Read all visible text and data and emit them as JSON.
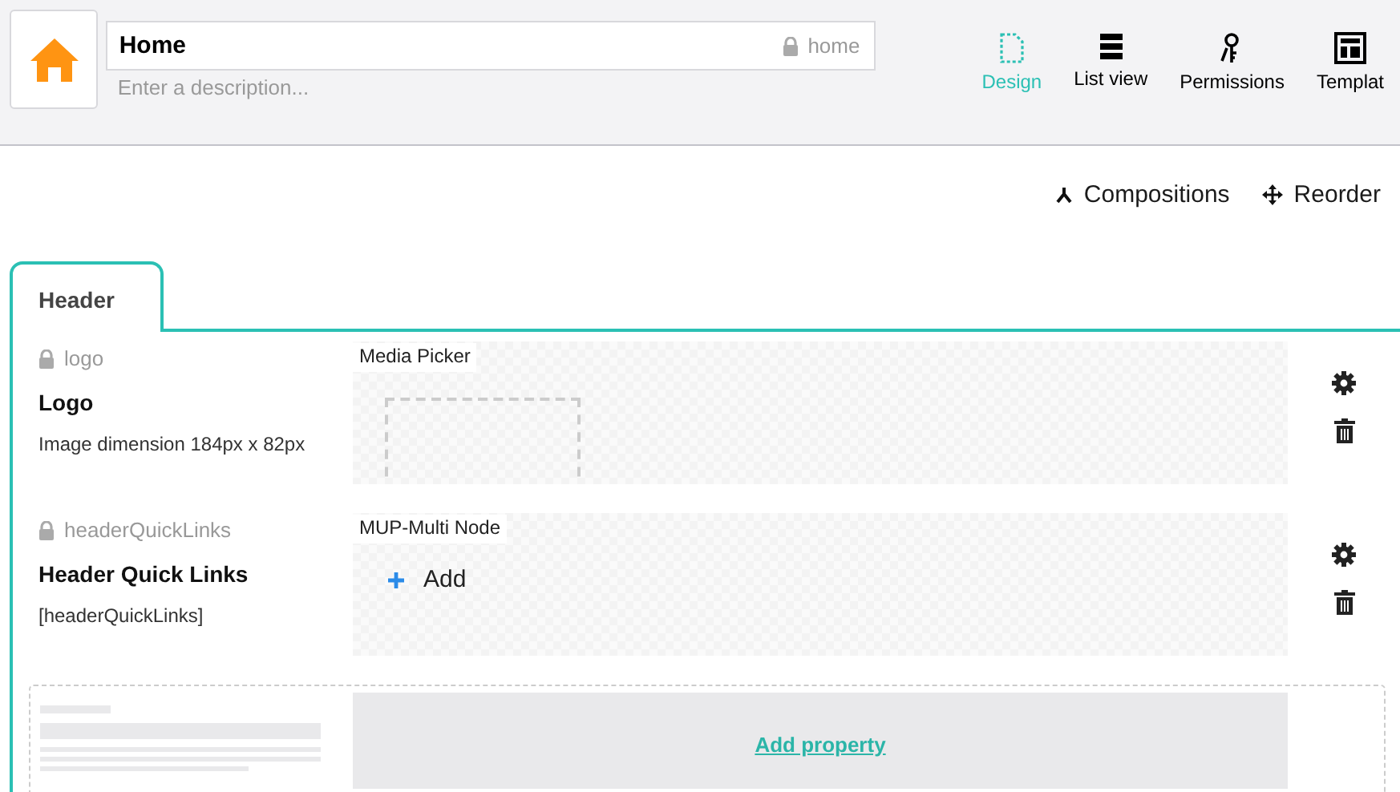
{
  "node": {
    "name": "Home",
    "alias": "home",
    "alias_locked": true,
    "description_placeholder": "Enter a description..."
  },
  "apps": [
    {
      "kind": "design",
      "label": "Design",
      "selected": true
    },
    {
      "kind": "list",
      "label": "List view",
      "selected": false
    },
    {
      "kind": "permissions",
      "label": "Permissions",
      "selected": false
    },
    {
      "kind": "templates",
      "label": "Templat",
      "selected": false
    }
  ],
  "toolbar": [
    {
      "kind": "compositions",
      "label": "Compositions"
    },
    {
      "kind": "reorder",
      "label": "Reorder"
    }
  ],
  "tabs": [
    {
      "label": "Header",
      "selected": true
    }
  ],
  "properties": [
    {
      "kind": "media-picker",
      "alias": "logo",
      "locked": true,
      "name": "Logo",
      "description": "Image dimension 184px x 82px",
      "editor": "Media Picker"
    },
    {
      "kind": "multi-node",
      "alias": "headerQuickLinks",
      "locked": true,
      "name": "Header Quick Links",
      "description": "[headerQuickLinks]",
      "editor": "MUP-Multi Node",
      "add_label": "Add"
    }
  ],
  "add_property": "Add property"
}
